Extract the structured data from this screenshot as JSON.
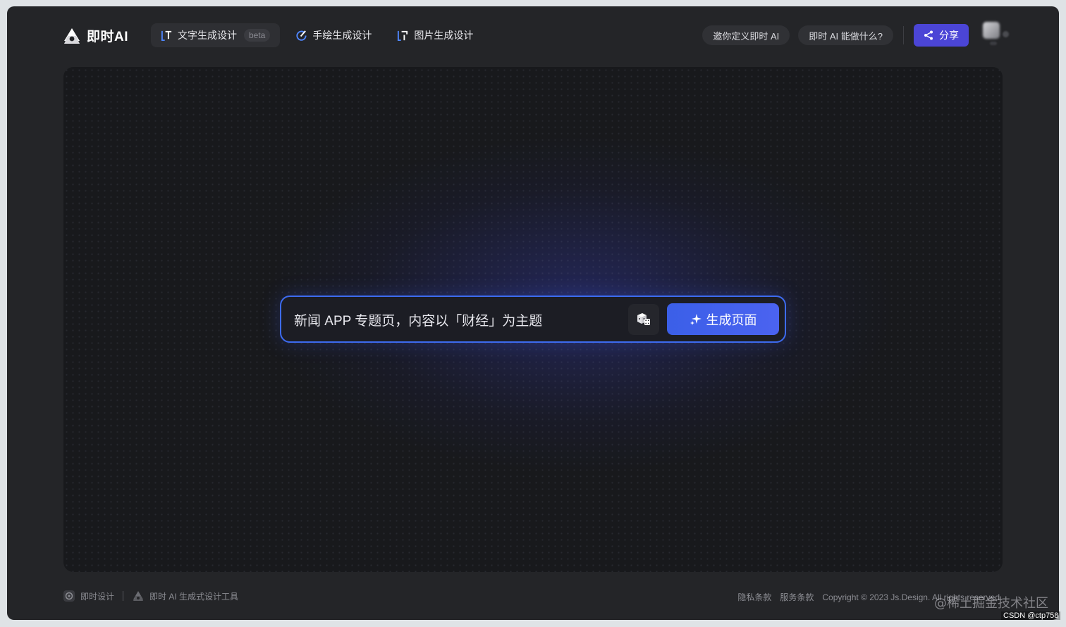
{
  "app": {
    "logo_text": "即时AI"
  },
  "tabs": [
    {
      "label": "文字生成设计",
      "badge": "beta",
      "icon": "text-generate-icon",
      "active": true
    },
    {
      "label": "手绘生成设计",
      "icon": "sketch-generate-icon",
      "active": false
    },
    {
      "label": "图片生成设计",
      "icon": "image-generate-icon",
      "active": false
    }
  ],
  "nav": {
    "invite_label": "邀你定义即时 AI",
    "what_label": "即时 AI 能做什么?",
    "share_label": "分享"
  },
  "prompt": {
    "value": "新闻 APP 专题页，内容以「财经」为主题",
    "dice_icon": "dice-icon",
    "generate_label": "生成页面",
    "generate_icon": "sparkle-icon"
  },
  "footer": {
    "brand_label": "即时设计",
    "tool_label": "即时 AI 生成式设计工具",
    "privacy_label": "隐私条款",
    "service_label": "服务条款",
    "copyright": "Copyright © 2023 Js.Design. All rights reserved"
  },
  "watermarks": {
    "community": "@稀土掘金技术社区",
    "csdn": "CSDN @ctp758"
  },
  "colors": {
    "window_bg": "#242528",
    "accent": "#3d6bf0",
    "share_button": "#4b45d6"
  }
}
